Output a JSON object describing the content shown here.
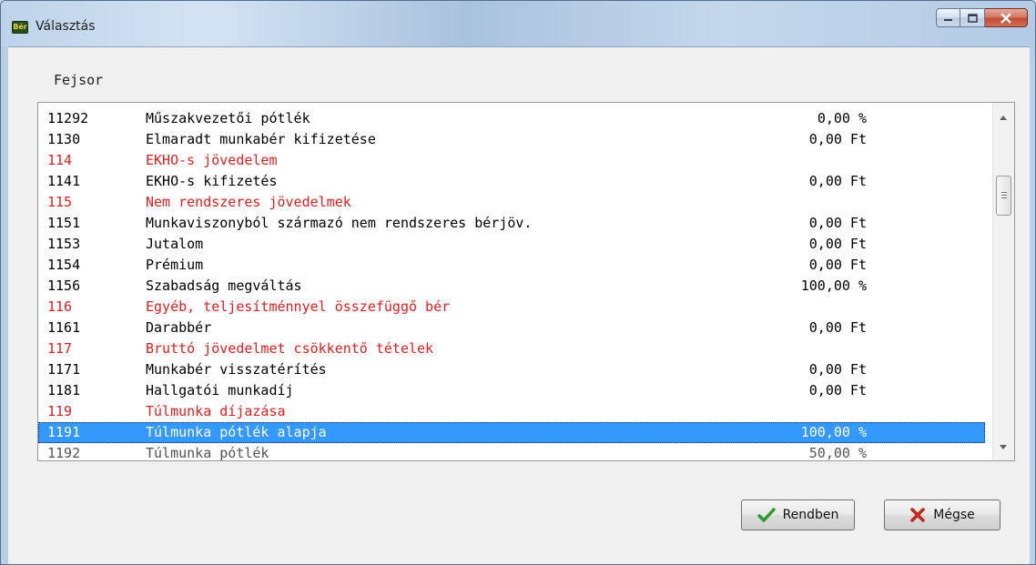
{
  "window": {
    "title": "Választás",
    "app_icon_text": "Bér"
  },
  "header": {
    "label": "Fejsor"
  },
  "list": {
    "rows": [
      {
        "code": "11292",
        "desc": "Műszakvezetői pótlék",
        "value": "0,00 %",
        "style": "normal"
      },
      {
        "code": "1130",
        "desc": "Elmaradt munkabér kifizetése",
        "value": "0,00 Ft",
        "style": "normal"
      },
      {
        "code": "114",
        "desc": "EKHO-s jövedelem",
        "value": "",
        "style": "red"
      },
      {
        "code": "1141",
        "desc": "EKHO-s kifizetés",
        "value": "0,00 Ft",
        "style": "normal"
      },
      {
        "code": "115",
        "desc": "Nem rendszeres jövedelmek",
        "value": "",
        "style": "red"
      },
      {
        "code": "1151",
        "desc": "Munkaviszonyból származó nem rendszeres bérjöv.",
        "value": "0,00 Ft",
        "style": "normal"
      },
      {
        "code": "1153",
        "desc": "Jutalom",
        "value": "0,00 Ft",
        "style": "normal"
      },
      {
        "code": "1154",
        "desc": "Prémium",
        "value": "0,00 Ft",
        "style": "normal"
      },
      {
        "code": "1156",
        "desc": "Szabadság megváltás",
        "value": "100,00 %",
        "style": "normal"
      },
      {
        "code": "116",
        "desc": "Egyéb, teljesítménnyel összefüggő bér",
        "value": "",
        "style": "red"
      },
      {
        "code": "1161",
        "desc": "Darabbér",
        "value": "0,00 Ft",
        "style": "normal"
      },
      {
        "code": "117",
        "desc": "Bruttó jövedelmet csökkentő tételek",
        "value": "",
        "style": "red"
      },
      {
        "code": "1171",
        "desc": "Munkabér visszatérítés",
        "value": "0,00 Ft",
        "style": "normal"
      },
      {
        "code": "1181",
        "desc": "Hallgatói munkadíj",
        "value": "0,00 Ft",
        "style": "normal"
      },
      {
        "code": "119",
        "desc": "Túlmunka díjazása",
        "value": "",
        "style": "red"
      },
      {
        "code": "1191",
        "desc": "Túlmunka pótlék alapja",
        "value": "100,00 %",
        "style": "selected"
      },
      {
        "code": "1192",
        "desc": "Túlmunka pótlék",
        "value": "50,00 %",
        "style": "partial"
      }
    ]
  },
  "buttons": {
    "ok_label": "Rendben",
    "cancel_label": "Mégse"
  },
  "colors": {
    "selection": "#3399ff",
    "group_text": "#e02020",
    "ok_check": "#2e9a2e",
    "cancel_x": "#c0281c"
  },
  "icons": {
    "ok": "checkmark-icon",
    "cancel": "x-icon",
    "minimize": "minimize-icon",
    "maximize": "maximize-icon",
    "close": "close-icon"
  }
}
